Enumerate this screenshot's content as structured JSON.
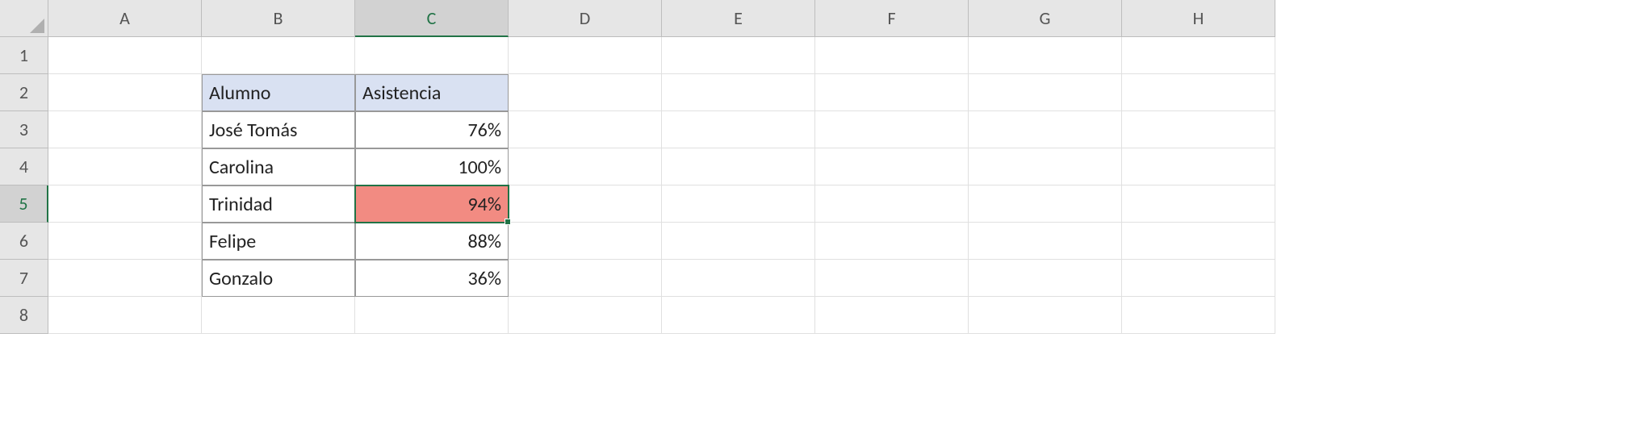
{
  "columns": [
    "A",
    "B",
    "C",
    "D",
    "E",
    "F",
    "G",
    "H"
  ],
  "rows": [
    "1",
    "2",
    "3",
    "4",
    "5",
    "6",
    "7",
    "8"
  ],
  "active_cell": {
    "col": "C",
    "row": "5"
  },
  "table": {
    "headers": {
      "b": "Alumno",
      "c": "Asistencia"
    },
    "data": [
      {
        "alumno": "José Tomás",
        "asistencia": "76%"
      },
      {
        "alumno": "Carolina",
        "asistencia": "100%"
      },
      {
        "alumno": "Trinidad",
        "asistencia": "94%",
        "highlight": true
      },
      {
        "alumno": "Felipe",
        "asistencia": "88%"
      },
      {
        "alumno": "Gonzalo",
        "asistencia": "36%"
      }
    ]
  }
}
